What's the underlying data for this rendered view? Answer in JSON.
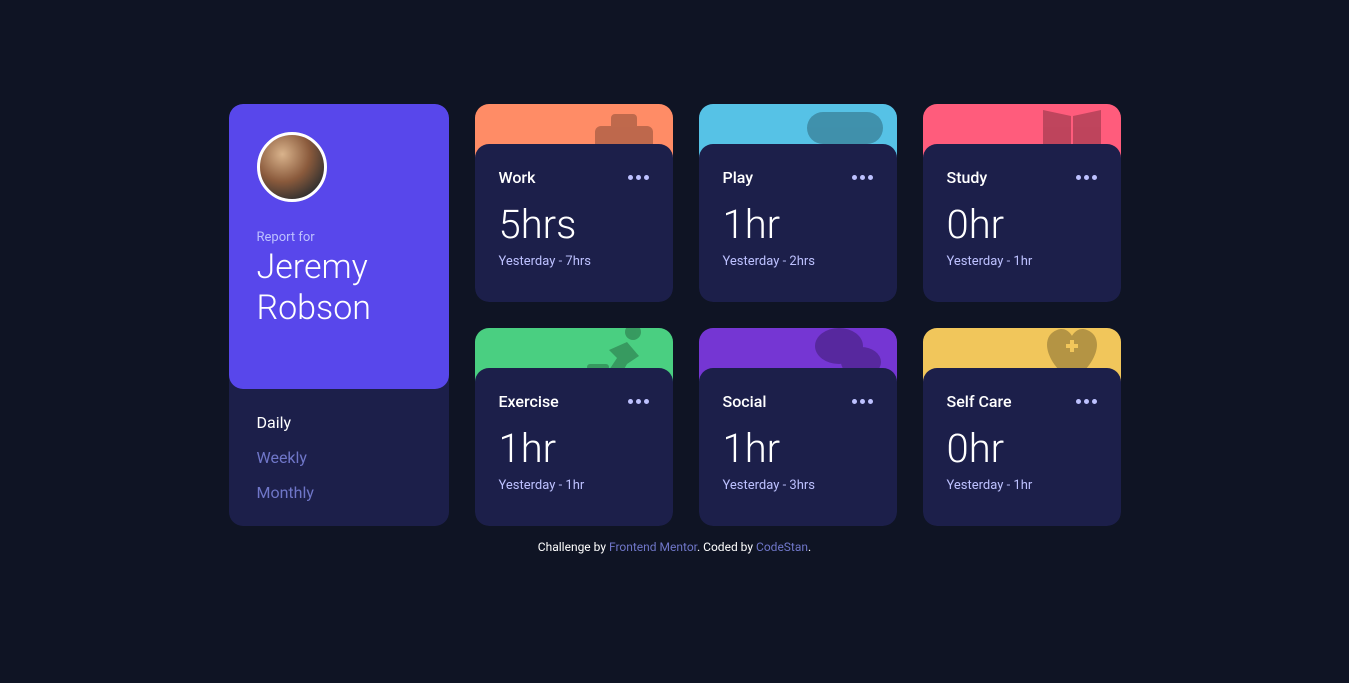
{
  "profile": {
    "report_for_label": "Report for",
    "name": "Jeremy Robson"
  },
  "periods": {
    "active": "daily",
    "daily": "Daily",
    "weekly": "Weekly",
    "monthly": "Monthly"
  },
  "cards": {
    "work": {
      "title": "Work",
      "current": "5hrs",
      "previous": "Yesterday - 7hrs",
      "color": "#ff8c66",
      "icon": "briefcase-icon"
    },
    "play": {
      "title": "Play",
      "current": "1hr",
      "previous": "Yesterday - 2hrs",
      "color": "#56c2e6",
      "icon": "gamepad-icon"
    },
    "study": {
      "title": "Study",
      "current": "0hr",
      "previous": "Yesterday - 1hr",
      "color": "#ff5c7c",
      "icon": "book-icon"
    },
    "exercise": {
      "title": "Exercise",
      "current": "1hr",
      "previous": "Yesterday - 1hr",
      "color": "#4acf81",
      "icon": "running-icon"
    },
    "social": {
      "title": "Social",
      "current": "1hr",
      "previous": "Yesterday - 3hrs",
      "color": "#7536d3",
      "icon": "chat-icon"
    },
    "selfcare": {
      "title": "Self Care",
      "current": "0hr",
      "previous": "Yesterday - 1hr",
      "color": "#f1c65b",
      "icon": "heart-icon"
    }
  },
  "attribution": {
    "prefix": "Challenge by ",
    "link1_text": "Frontend Mentor",
    "middle": ". Coded by ",
    "link2_text": "CodeStan",
    "suffix": "."
  }
}
